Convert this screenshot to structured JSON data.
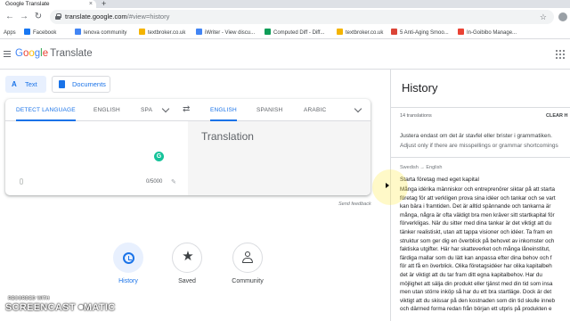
{
  "browser": {
    "tab_title": "Google Translate",
    "url_host": "translate.google.com",
    "url_path": "/#view=history",
    "bookmarks": [
      {
        "label": "Apps",
        "color": "#5f6368"
      },
      {
        "label": "Facebook",
        "color": "#1877f2"
      },
      {
        "label": "lenova community",
        "color": "#4285f4"
      },
      {
        "label": "textbroker.co.uk",
        "color": "#f4b400"
      },
      {
        "label": "iWriter - View discu...",
        "color": "#4285f4"
      },
      {
        "label": "Computed Diff - Diff...",
        "color": "#0f9d58"
      },
      {
        "label": "textbroker.co.uk",
        "color": "#f4b400"
      },
      {
        "label": "5 Anti-Aging Smoo...",
        "color": "#db4437"
      },
      {
        "label": "In-Goibibo Manage...",
        "color": "#ea4335"
      }
    ]
  },
  "header": {
    "logo_letters": [
      "G",
      "o",
      "o",
      "g",
      "l",
      "e"
    ],
    "product": "Translate"
  },
  "modes": {
    "text_label": "Text",
    "documents_label": "Documents"
  },
  "translator": {
    "source_langs": [
      "DETECT LANGUAGE",
      "ENGLISH",
      "SPA"
    ],
    "target_langs": [
      "ENGLISH",
      "SPANISH",
      "ARABIC"
    ],
    "placeholder": "Translation",
    "char_count": "0/5000",
    "grammarly_letter": "G",
    "send_feedback": "Send feedback"
  },
  "bottom_nav": {
    "history": "History",
    "saved": "Saved",
    "community": "Community"
  },
  "watermark": {
    "line1": "RECORDED WITH",
    "line2": "SCREENCAST",
    "line3": "MATIC"
  },
  "history": {
    "title": "History",
    "count": "14 translations",
    "clear": "CLEAR H",
    "entry1_line1": "Justera endast om det är stavfel eller brister i grammatiken.",
    "entry1_line2": "Adjust only if there are misspellings or grammar shortcomings",
    "pair": "Swedish → English",
    "source_title": "Starta företag med eget kapital",
    "body_lines": [
      "Många idérika människor och entreprenörer siktar på att starta",
      "företag för att verkligen prova sina idéer och tankar och se vart",
      "kan bära i framtiden. Det är alltid spännande och tankarna är",
      "många, några är ofta väldigt bra men kräver sitt startkapital för",
      "förverkligas. När du sitter med dina tankar är det viktigt att du",
      "tänker realistiskt, utan att tappa visioner och idéer. Ta fram en",
      "struktur som ger dig en överblick på behovet av inkomster och",
      "faktiska utgifter. Här har skatteverket och många låneinstitut,",
      "färdiga mallar som du lätt kan anpassa efter dina behov och f",
      "för att få en överblick. Olika företagsidéer har olika kapitalbeh",
      "det är viktigt att du tar fram ditt egna kapitalbehov. Har du",
      "möjlighet att sälja din produkt eller tjänst med din tid som insa",
      "men utan större inköp så har du ett bra startläge. Dock är det",
      "viktigt att du skissar på den kostnaden som din tid skulle inneb",
      "och därmed forma redan från början ett utpris på produkten e"
    ]
  },
  "colors": {
    "accent": "#1a73e8",
    "accent_light": "#e8f0fe",
    "grammarly": "#15c39a"
  }
}
